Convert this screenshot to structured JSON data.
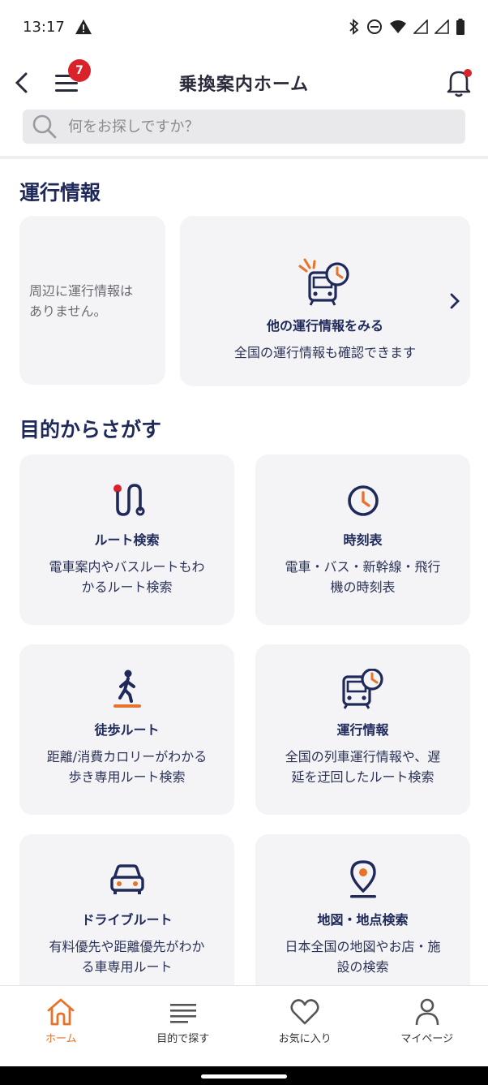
{
  "status_bar": {
    "time": "13:17"
  },
  "header": {
    "title": "乗換案内ホーム",
    "menu_badge": "7"
  },
  "search": {
    "placeholder": "何をお探しですか？"
  },
  "operation_section": {
    "title": "運行情報",
    "nearby_text_line1": "周辺に運行情報は",
    "nearby_text_line2": "ありません。",
    "other_title": "他の運行情報をみる",
    "other_desc": "全国の運行情報も確認できます"
  },
  "purpose_section": {
    "title": "目的からさがす",
    "cards": [
      {
        "title": "ルート検索",
        "desc1": "電車案内やバスルートもわ",
        "desc2": "かるルート検索",
        "icon": "route-icon"
      },
      {
        "title": "時刻表",
        "desc1": "電車・バス・新幹線・飛行",
        "desc2": "機の時刻表",
        "icon": "clock-icon"
      },
      {
        "title": "徒歩ルート",
        "desc1": "距離/消費カロリーがわかる",
        "desc2": "歩き専用ルート検索",
        "icon": "walk-icon"
      },
      {
        "title": "運行情報",
        "desc1": "全国の列車運行情報や、遅",
        "desc2": "延を迂回したルート検索",
        "icon": "train-clock-icon"
      },
      {
        "title": "ドライブルート",
        "desc1": "有料優先や距離優先がわか",
        "desc2": "る車専用ルート",
        "icon": "car-icon"
      },
      {
        "title": "地図・地点検索",
        "desc1": "日本全国の地図やお店・施",
        "desc2": "設の検索",
        "icon": "map-pin-icon"
      }
    ]
  },
  "bottom_nav": {
    "items": [
      {
        "label": "ホーム",
        "icon": "home-icon",
        "active": true
      },
      {
        "label": "目的で探す",
        "icon": "list-icon",
        "active": false
      },
      {
        "label": "お気に入り",
        "icon": "heart-icon",
        "active": false
      },
      {
        "label": "マイページ",
        "icon": "person-icon",
        "active": false
      }
    ]
  },
  "colors": {
    "navy": "#1f2a5a",
    "orange": "#e8722a",
    "badge_red": "#d8232a",
    "card_bg": "#f4f4f6"
  }
}
